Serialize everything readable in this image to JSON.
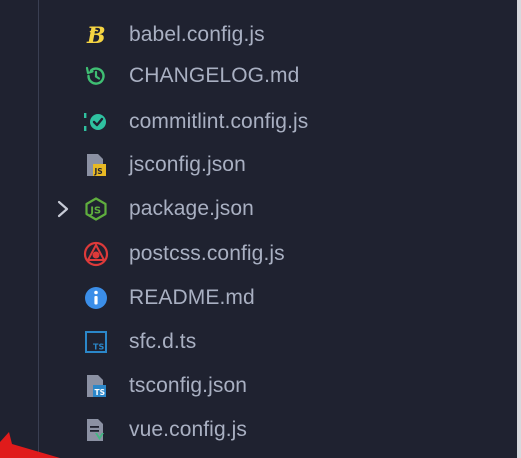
{
  "explorer": {
    "files": [
      {
        "name": "babel.config.js",
        "icon": "babel-icon"
      },
      {
        "name": "CHANGELOG.md",
        "icon": "changelog-icon"
      },
      {
        "name": "commitlint.config.js",
        "icon": "commitlint-icon"
      },
      {
        "name": "jsconfig.json",
        "icon": "jsconfig-icon"
      },
      {
        "name": "package.json",
        "icon": "nodejs-icon",
        "expandable": true
      },
      {
        "name": "postcss.config.js",
        "icon": "postcss-icon"
      },
      {
        "name": "README.md",
        "icon": "info-icon"
      },
      {
        "name": "sfc.d.ts",
        "icon": "typescript-icon"
      },
      {
        "name": "tsconfig.json",
        "icon": "tsconfig-icon"
      },
      {
        "name": "vue.config.js",
        "icon": "vue-config-icon"
      }
    ]
  },
  "colors": {
    "background": "#1f2230",
    "text": "#a9b0c2",
    "babel": "#f5d442",
    "changelog": "#3fbf73",
    "commitlint": "#2fc1a0",
    "json_yellow": "#e8b924",
    "node": "#5fae3e",
    "postcss": "#dd3a3a",
    "info": "#3b8ee8",
    "typescript": "#2b87c9",
    "vue": "#41b883",
    "annotation_red": "#e01b1b"
  }
}
